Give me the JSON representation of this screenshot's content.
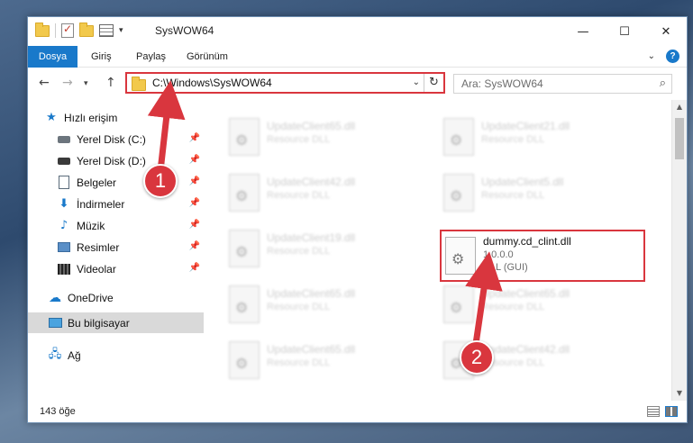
{
  "window": {
    "title": "SysWOW64",
    "controls": {
      "minimize": "—",
      "maximize": "☐",
      "close": "✕"
    }
  },
  "ribbon": {
    "file_tab": "Dosya",
    "tabs": [
      "Giriş",
      "Paylaş",
      "Görünüm"
    ]
  },
  "nav": {
    "address": "C:\\Windows\\SysWOW64",
    "search_placeholder": "Ara: SysWOW64"
  },
  "sidebar": {
    "items": [
      {
        "label": "Hızlı erişim",
        "icon": "star-icon"
      },
      {
        "label": "Yerel Disk (C:)",
        "icon": "drive-icon",
        "pinned": true
      },
      {
        "label": "Yerel Disk (D:)",
        "icon": "drive-icon",
        "pinned": true
      },
      {
        "label": "Belgeler",
        "icon": "documents-icon",
        "pinned": true
      },
      {
        "label": "İndirmeler",
        "icon": "downloads-icon",
        "pinned": true
      },
      {
        "label": "Müzik",
        "icon": "music-icon",
        "pinned": true
      },
      {
        "label": "Resimler",
        "icon": "pictures-icon",
        "pinned": true
      },
      {
        "label": "Videolar",
        "icon": "videos-icon",
        "pinned": true
      },
      {
        "label": "OneDrive",
        "icon": "cloud-icon"
      },
      {
        "label": "Bu bilgisayar",
        "icon": "computer-icon",
        "selected": true
      },
      {
        "label": "Ağ",
        "icon": "network-icon"
      }
    ]
  },
  "files": [
    {
      "name": "UpdateClient65.dll",
      "type": "Resource DLL"
    },
    {
      "name": "UpdateClient21.dll",
      "type": "Resource DLL"
    },
    {
      "name": "UpdateClient42.dll",
      "type": "Resource DLL"
    },
    {
      "name": "UpdateClient5.dll",
      "type": "Resource DLL"
    },
    {
      "name": "UpdateClient19.dll",
      "type": "Resource DLL"
    },
    {
      "name": "UpdateClient65.dll",
      "type": "Resource DLL"
    },
    {
      "name": "UpdateClient65.dll",
      "type": "Resource DLL"
    },
    {
      "name": "UpdateClient65.dll",
      "type": "Resource DLL"
    },
    {
      "name": "UpdateClient42.dll",
      "type": "Resource DLL"
    }
  ],
  "highlighted_file": {
    "name": "dummy.cd_clint.dll",
    "version": "1.0.0.0",
    "type": "DLL (GUI)"
  },
  "status": {
    "item_count": "143 öğe"
  },
  "annotations": {
    "marker1": "1",
    "marker2": "2",
    "color": "#d9363e"
  }
}
